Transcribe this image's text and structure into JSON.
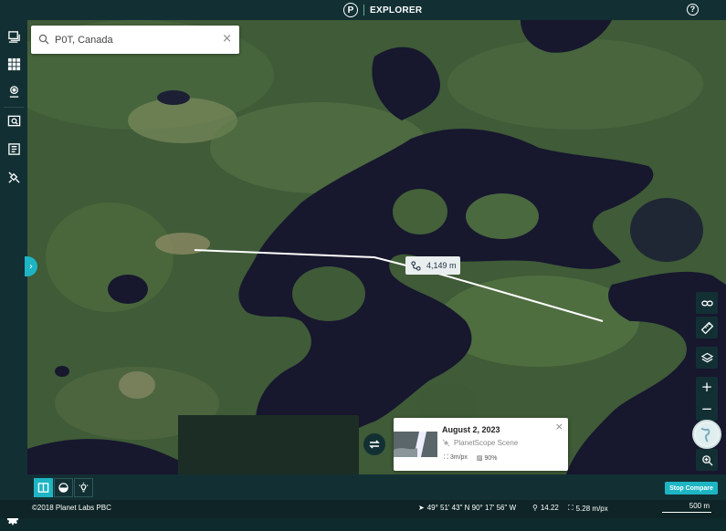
{
  "app": {
    "title": "EXPLORER",
    "logo_letter": "P",
    "help_icon": "help-icon"
  },
  "sidebar": {
    "items": [
      {
        "icon": "layers-stack-icon"
      },
      {
        "icon": "grid-icon"
      },
      {
        "icon": "map-pin-icon"
      },
      {
        "icon": "image-search-icon"
      },
      {
        "icon": "document-icon"
      },
      {
        "icon": "satellite-icon"
      }
    ],
    "settings_icon": "gear-icon"
  },
  "search": {
    "value": "P0T, Canada",
    "clear": "×"
  },
  "collapse_tab": {
    "glyph": "›"
  },
  "measurement": {
    "distance": "4,149 m"
  },
  "map_controls": {
    "link_icon": "link-icon",
    "ruler_icon": "ruler-icon",
    "layers_icon": "layers-icon",
    "zoom_in": "+",
    "zoom_out": "−",
    "search_zoom_icon": "magnify-icon"
  },
  "scene_card": {
    "date": "August 2, 2023",
    "type": "PlanetScope Scene",
    "resolution": "3m/px",
    "cloud_cover": "90%",
    "close": "×"
  },
  "toolbar": {
    "stop_compare_label": "Stop Compare"
  },
  "status": {
    "copyright": "©2018 Planet Labs PBC",
    "coordinates": "49° 51' 43\" N 90° 17' 56\" W",
    "zoom": "14.22",
    "resolution": "5.28 m/px",
    "scale_label": "500 m"
  },
  "colors": {
    "accent": "#1db5c4",
    "chrome": "#123034",
    "water": "#17172e",
    "forest": "#3f5b37"
  }
}
